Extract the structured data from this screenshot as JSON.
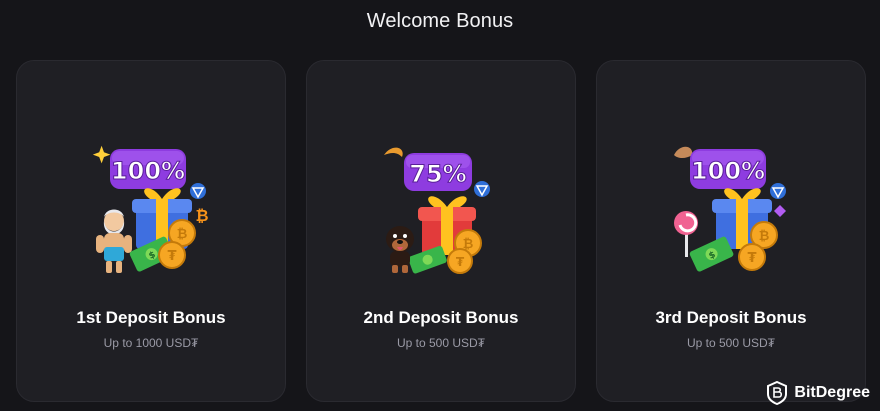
{
  "header": {
    "title": "Welcome Bonus"
  },
  "cards": [
    {
      "percent": "100%",
      "title": "1st Deposit Bonus",
      "subtitle": "Up to 1000 USD₮",
      "mascot": "zeus-character",
      "crypto": [
        "bitcoin-icon",
        "ton-icon"
      ]
    },
    {
      "percent": "75%",
      "title": "2nd Deposit Bonus",
      "subtitle": "Up to 500 USD₮",
      "mascot": "rottweiler-character",
      "crypto": [
        "ton-icon"
      ]
    },
    {
      "percent": "100%",
      "title": "3rd Deposit Bonus",
      "subtitle": "Up to 500 USD₮",
      "mascot": "lollipop",
      "crypto": [
        "ton-icon"
      ]
    }
  ],
  "watermark": {
    "text": "BitDegree"
  },
  "colors": {
    "background": "#151519",
    "card": "#1f1f24",
    "badge": "#8e3ce0",
    "gift_box": "#3f6fe0",
    "gift_ribbon": "#ffc21f",
    "coin": "#f6a623",
    "subtitle": "#9a9aa6"
  }
}
